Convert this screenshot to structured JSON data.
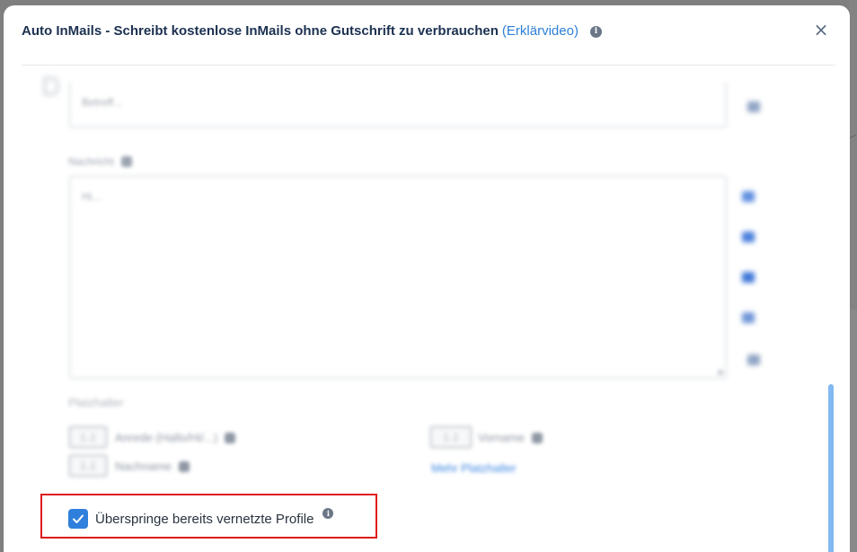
{
  "modal": {
    "title": "Auto InMails - Schreibt kostenlose InMails ohne Gutschrift zu verbrauchen",
    "video_link": "(Erklärvideo)",
    "info_icon_glyph": "i",
    "close_glyph": "×"
  },
  "form": {
    "subject_value": "Betreff...",
    "message_label": "Nachricht",
    "message_value": "Hi...",
    "placeholders_label": "Platzhalter",
    "placeholders": [
      {
        "chip": "[...]",
        "label": "Anrede (Hallo/Hi/...)"
      },
      {
        "chip": "[...]",
        "label": "Vorname"
      },
      {
        "chip": "[...]",
        "label": "Nachname"
      }
    ],
    "more_placeholders": "Mehr Platzhalter",
    "skip_connected": {
      "label": "Überspringe bereits vernetzte Profile",
      "checked": true
    }
  },
  "colors": {
    "accent": "#2f7fdc",
    "title": "#1c3151",
    "highlight": "#e01b1b"
  }
}
